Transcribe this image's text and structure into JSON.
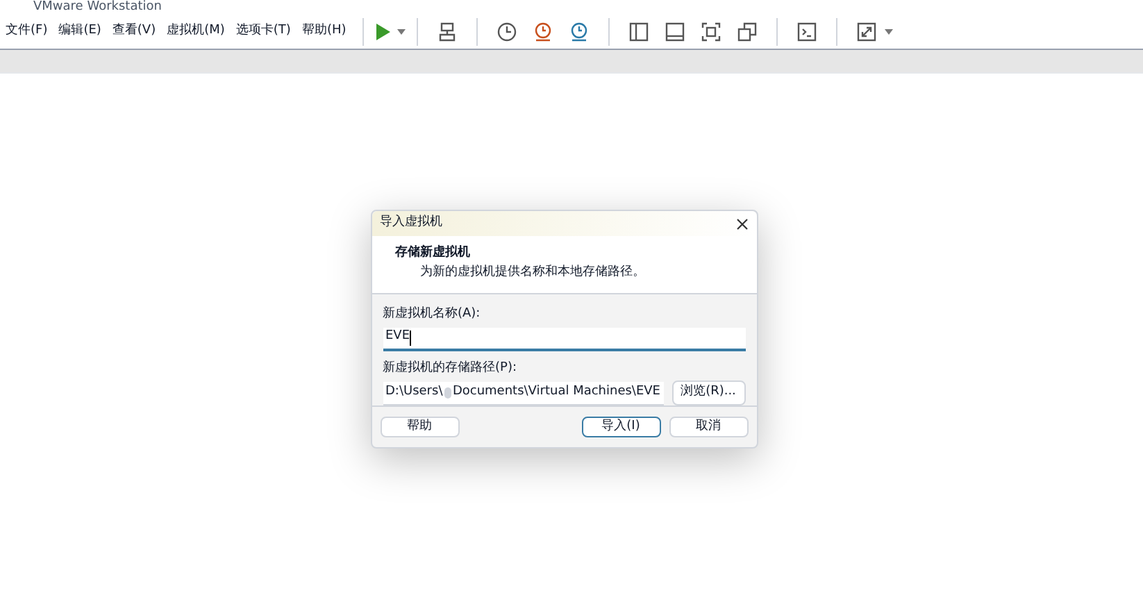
{
  "window": {
    "title": "VMware Workstation"
  },
  "menu": [
    "文件(F)",
    "编辑(E)",
    "查看(V)",
    "虚拟机(M)",
    "选项卡(T)",
    "帮助(H)"
  ],
  "dialog": {
    "title": "导入虚拟机",
    "heading": "存储新虚拟机",
    "subheading": "为新的虚拟机提供名称和本地存储路径。",
    "name_label": "新虚拟机名称(A):",
    "name_value": "EVE",
    "path_label": "新虚拟机的存储路径(P):",
    "path_start": "D:\\Users\\",
    "path_end": "Documents\\Virtual Machines\\EVE",
    "browse": "浏览(R)...",
    "buttons": [
      {
        "label": "帮助",
        "selected": false
      },
      {
        "label": "导入(I)",
        "selected": true
      },
      {
        "label": "取消",
        "selected": false
      }
    ]
  }
}
